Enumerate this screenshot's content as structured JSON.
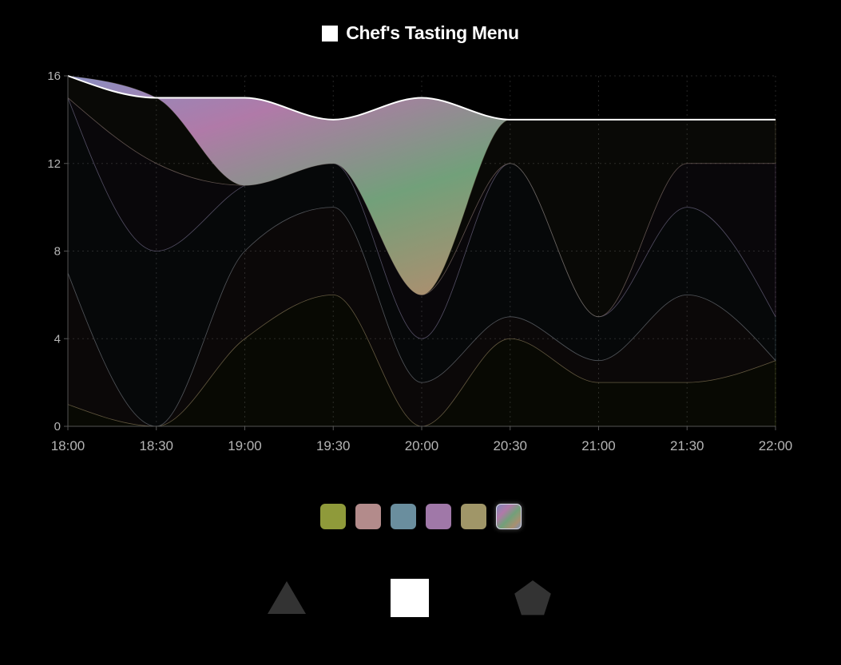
{
  "title": "Chef's Tasting Menu",
  "colors": {
    "background": "#000000",
    "top_line": "#ffffff",
    "grid": "#262626",
    "axis": "#555555",
    "shape_inactive": "#333333",
    "shape_active": "#ffffff"
  },
  "chart_data": {
    "type": "area",
    "stacked": true,
    "smooth": true,
    "x": [
      "18:00",
      "18:30",
      "19:00",
      "19:30",
      "20:00",
      "20:30",
      "21:00",
      "21:30",
      "22:00"
    ],
    "ylim": [
      0,
      16
    ],
    "yticks": [
      0,
      4,
      8,
      12,
      16
    ],
    "grid": true,
    "highlighted_series": 5,
    "series": [
      {
        "values": [
          1,
          0,
          4,
          6,
          0,
          4,
          2,
          2,
          3
        ],
        "color": "#8f9a3a"
      },
      {
        "values": [
          6,
          0,
          4,
          4,
          2,
          1,
          1,
          4,
          0
        ],
        "color": "#b38b8b"
      },
      {
        "values": [
          8,
          8,
          3,
          2,
          2,
          7,
          2,
          4,
          2
        ],
        "color": "#6a8e9e"
      },
      {
        "values": [
          0,
          4,
          0,
          0,
          2,
          0,
          0,
          2,
          7
        ],
        "color": "#a078a8"
      },
      {
        "values": [
          1,
          3,
          0,
          0,
          0,
          2,
          9,
          2,
          2
        ],
        "color": "#a09668"
      },
      {
        "values": [
          0,
          0,
          4,
          2,
          9,
          0,
          0,
          0,
          0
        ],
        "color": "gradient"
      }
    ]
  },
  "swatches": [
    {
      "color": "#8f9a3a"
    },
    {
      "color": "#b38b8b"
    },
    {
      "color": "#6a8e9e"
    },
    {
      "color": "#a078a8"
    },
    {
      "color": "#a09668"
    },
    {
      "color": "gradient"
    }
  ],
  "shapes": [
    {
      "icon": "triangle-icon",
      "active": false
    },
    {
      "icon": "square-icon",
      "active": true
    },
    {
      "icon": "pentagon-icon",
      "active": false
    }
  ]
}
